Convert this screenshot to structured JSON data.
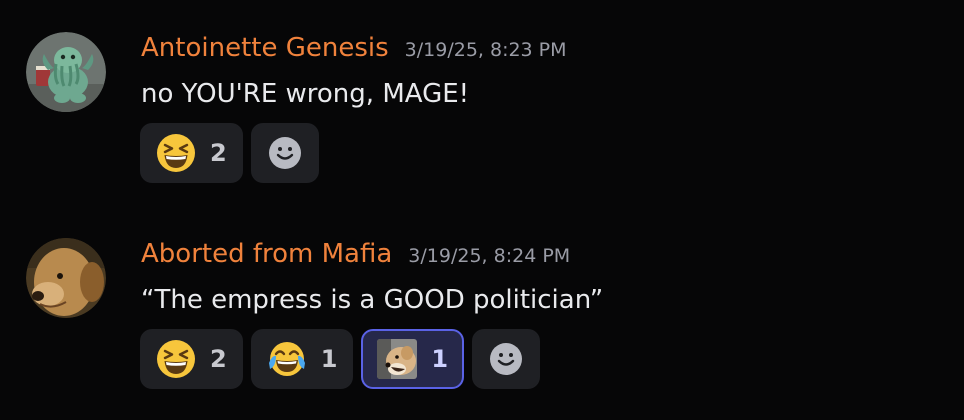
{
  "messages": [
    {
      "username": "Antoinette Genesis",
      "timestamp": "3/19/25, 8:23 PM",
      "content": "no YOU'RE wrong, MAGE!",
      "avatar": "cthulhu-avatar",
      "reactions": [
        {
          "emoji": "laughing-emoji",
          "count": "2",
          "active": false
        }
      ]
    },
    {
      "username": "Aborted from Mafia",
      "timestamp": "3/19/25, 8:24 PM",
      "content": "“The empress is a GOOD politician”",
      "avatar": "dog-avatar",
      "reactions": [
        {
          "emoji": "laughing-emoji",
          "count": "2",
          "active": false
        },
        {
          "emoji": "joy-emoji",
          "count": "1",
          "active": false
        },
        {
          "emoji": "doge-custom-emoji",
          "count": "1",
          "active": true
        }
      ]
    }
  ],
  "colors": {
    "background": "#060607",
    "username": "#f0823c",
    "timestamp": "#9a9ca6",
    "text": "#e9eaed",
    "reaction_bg": "#1f2024",
    "reaction_active_border": "#5a62e6"
  }
}
